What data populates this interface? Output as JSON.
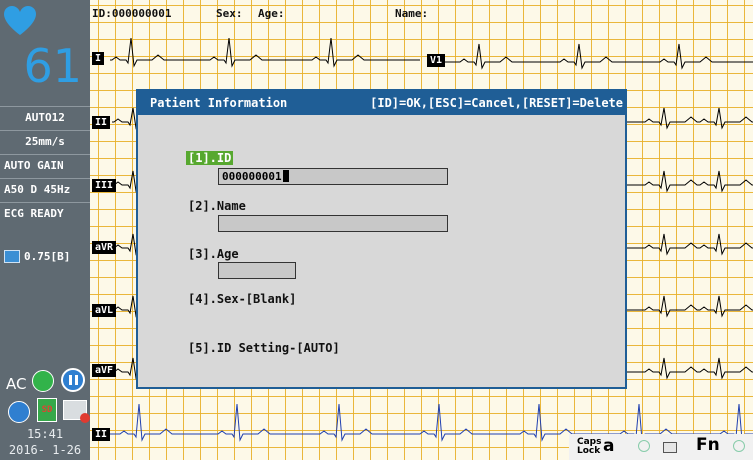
{
  "sidebar": {
    "heart_rate": "61",
    "mode": "AUTO12",
    "speed": "25mm/s",
    "gain": "AUTO GAIN",
    "filter": "A50 D 45Hz",
    "status": "ECG READY",
    "battery_value": "0.75[B]",
    "ac_label": "AC",
    "time": "15:41",
    "date": "2016- 1-26"
  },
  "header": {
    "id_text": "ID:000000001",
    "sex_label": "Sex:",
    "age_label": "Age:",
    "name_label": "Name:"
  },
  "leads": {
    "i": "I",
    "v1": "V1",
    "ii": "II",
    "iii": "III",
    "avr": "aVR",
    "avl": "aVL",
    "avf": "aVF",
    "rhythm": "II"
  },
  "dialog": {
    "title": "Patient Information",
    "keys_hint": "[ID]=OK,[ESC]=Cancel,[RESET]=Delete",
    "fields": [
      {
        "label": "[1].ID",
        "value": "000000001",
        "active": true
      },
      {
        "label": "[2].Name",
        "value": ""
      },
      {
        "label": "[3].Age",
        "value": ""
      },
      {
        "label": "[4].Sex-[Blank]"
      },
      {
        "label": "[5].ID Setting-[AUTO]"
      }
    ]
  },
  "tray": {
    "caps_line1": "Caps",
    "caps_line2": "Lock",
    "caps_letter": "a",
    "fn_label": "Fn"
  },
  "colors": {
    "sidebar_bg": "#5f6a72",
    "heart": "#2f9ee3",
    "grid": "#e8b028",
    "dialog_title_bg": "#1f5e96",
    "dialog_bg": "#d8d8d8",
    "active_field": "#57a82f",
    "trace": "#000000",
    "rhythm_trace": "#1f3fb0"
  }
}
